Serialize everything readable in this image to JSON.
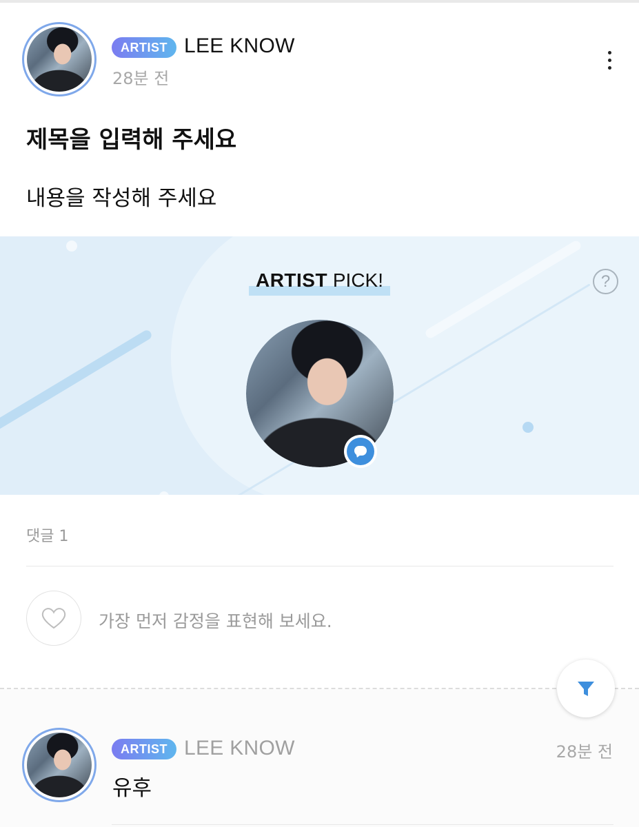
{
  "post": {
    "badge": "ARTIST",
    "author": "LEE KNOW",
    "time": "28분 전",
    "title": "제목을 입력해 주세요",
    "body": "내용을 작성해 주세요"
  },
  "artist_pick": {
    "title_bold": "ARTIST",
    "title_rest": " PICK!",
    "help": "?"
  },
  "comments": {
    "count_label": "댓글 1",
    "reaction_prompt": "가장 먼저 감정을 표현해 보세요.",
    "items": [
      {
        "badge": "ARTIST",
        "author": "LEE KNOW",
        "time": "28분 전",
        "text": "유후"
      }
    ]
  },
  "icons": {
    "more": "more-vertical-icon",
    "help": "question-icon",
    "chat": "chat-bubble-icon",
    "heart": "heart-icon",
    "filter": "filter-icon"
  },
  "colors": {
    "accent": "#3e8fdd",
    "badge_start": "#7b7cf0",
    "badge_end": "#5fb6ee",
    "banner_bg": "#e0eef9",
    "avatar_ring": "#7fa8ea"
  }
}
